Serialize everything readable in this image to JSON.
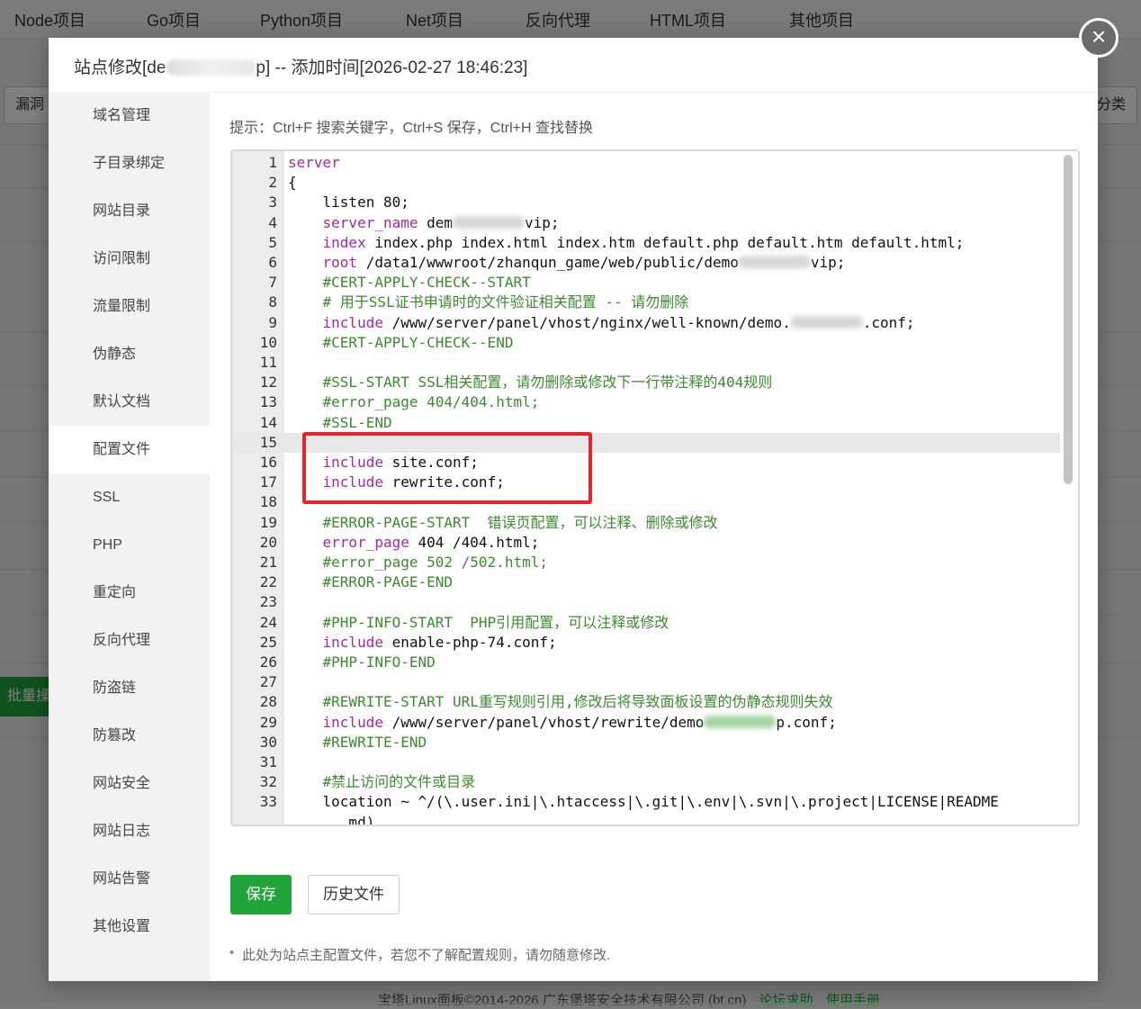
{
  "background": {
    "nav": [
      "Node项目",
      "Go项目",
      "Python项目",
      "Net项目",
      "反向代理",
      "HTML项目",
      "其他项目"
    ],
    "chip_left": "漏洞",
    "chip_right": "分类",
    "batch_button": "批量操",
    "footer": "宝塔Linux面板©2014-2026 广东堡塔安全技术有限公司 (bt.cn)",
    "footer_links": [
      "论坛求助",
      "使用手册"
    ]
  },
  "modal": {
    "title_prefix": "站点修改[de",
    "title_suffix": "p] -- 添加时间[2026-02-27 18:46:23]",
    "close_icon": "×"
  },
  "sidebar": {
    "items": [
      "域名管理",
      "子目录绑定",
      "网站目录",
      "访问限制",
      "流量限制",
      "伪静态",
      "默认文档",
      "配置文件",
      "SSL",
      "PHP",
      "重定向",
      "反向代理",
      "防盗链",
      "防篡改",
      "网站安全",
      "网站日志",
      "网站告警",
      "其他设置"
    ],
    "active_index": 7
  },
  "content": {
    "tip": "提示：Ctrl+F 搜索关键字，Ctrl+S 保存，Ctrl+H 查找替换",
    "save_button": "保存",
    "history_button": "历史文件",
    "note": "此处为站点主配置文件，若您不了解配置规则，请勿随意修改."
  },
  "editor": {
    "highlighted_line": 15,
    "lines": [
      {
        "n": "1",
        "parts": [
          [
            "kw",
            "server"
          ]
        ]
      },
      {
        "n": "2",
        "parts": [
          [
            "",
            "{"
          ]
        ]
      },
      {
        "n": "3",
        "parts": [
          [
            "",
            "    listen 80;"
          ]
        ]
      },
      {
        "n": "4",
        "parts": [
          [
            "",
            "    "
          ],
          [
            "kw",
            "server_name"
          ],
          [
            "",
            " dem"
          ],
          [
            "blur",
            ""
          ],
          [
            "",
            "vip;"
          ]
        ]
      },
      {
        "n": "5",
        "parts": [
          [
            "",
            "    "
          ],
          [
            "kw",
            "index"
          ],
          [
            "",
            " index.php index.html index.htm default.php default.htm default.html;"
          ]
        ]
      },
      {
        "n": "6",
        "parts": [
          [
            "",
            "    "
          ],
          [
            "kw",
            "root"
          ],
          [
            "",
            " /data1/wwwroot/zhanqun_game/web/public/demo"
          ],
          [
            "blur",
            ""
          ],
          [
            "",
            "vip;"
          ]
        ]
      },
      {
        "n": "7",
        "parts": [
          [
            "",
            "    "
          ],
          [
            "cmt",
            "#CERT-APPLY-CHECK--START"
          ]
        ]
      },
      {
        "n": "8",
        "parts": [
          [
            "",
            "    "
          ],
          [
            "cmt",
            "# 用于SSL证书申请时的文件验证相关配置 -- 请勿删除"
          ]
        ]
      },
      {
        "n": "9",
        "parts": [
          [
            "",
            "    "
          ],
          [
            "kw",
            "include"
          ],
          [
            "",
            " /www/server/panel/vhost/nginx/well-known/demo."
          ],
          [
            "blur",
            ""
          ],
          [
            "",
            ".conf;"
          ]
        ]
      },
      {
        "n": "10",
        "parts": [
          [
            "",
            "    "
          ],
          [
            "cmt",
            "#CERT-APPLY-CHECK--END"
          ]
        ]
      },
      {
        "n": "11",
        "parts": [
          [
            "",
            ""
          ]
        ]
      },
      {
        "n": "12",
        "parts": [
          [
            "",
            "    "
          ],
          [
            "cmt",
            "#SSL-START SSL相关配置，请勿删除或修改下一行带注释的404规则"
          ]
        ]
      },
      {
        "n": "13",
        "parts": [
          [
            "",
            "    "
          ],
          [
            "cmt",
            "#error_page 404/404.html;"
          ]
        ]
      },
      {
        "n": "14",
        "parts": [
          [
            "",
            "    "
          ],
          [
            "cmt",
            "#SSL-END"
          ]
        ]
      },
      {
        "n": "15",
        "parts": [
          [
            "",
            ""
          ]
        ]
      },
      {
        "n": "16",
        "parts": [
          [
            "",
            "    "
          ],
          [
            "kw",
            "include"
          ],
          [
            "",
            " site.conf;"
          ]
        ]
      },
      {
        "n": "17",
        "parts": [
          [
            "",
            "    "
          ],
          [
            "kw",
            "include"
          ],
          [
            "",
            " rewrite.conf;"
          ]
        ]
      },
      {
        "n": "18",
        "parts": [
          [
            "",
            ""
          ]
        ]
      },
      {
        "n": "19",
        "parts": [
          [
            "",
            "    "
          ],
          [
            "cmt",
            "#ERROR-PAGE-START  错误页配置，可以注释、删除或修改"
          ]
        ]
      },
      {
        "n": "20",
        "parts": [
          [
            "",
            "    "
          ],
          [
            "kw",
            "error_page"
          ],
          [
            "",
            " 404 /404.html;"
          ]
        ]
      },
      {
        "n": "21",
        "parts": [
          [
            "",
            "    "
          ],
          [
            "cmt",
            "#error_page 502 /502.html;"
          ]
        ]
      },
      {
        "n": "22",
        "parts": [
          [
            "",
            "    "
          ],
          [
            "cmt",
            "#ERROR-PAGE-END"
          ]
        ]
      },
      {
        "n": "23",
        "parts": [
          [
            "",
            ""
          ]
        ]
      },
      {
        "n": "24",
        "parts": [
          [
            "",
            "    "
          ],
          [
            "cmt",
            "#PHP-INFO-START  PHP引用配置，可以注释或修改"
          ]
        ]
      },
      {
        "n": "25",
        "parts": [
          [
            "",
            "    "
          ],
          [
            "kw",
            "include"
          ],
          [
            "",
            " enable-php-74.conf;"
          ]
        ]
      },
      {
        "n": "26",
        "parts": [
          [
            "",
            "    "
          ],
          [
            "cmt",
            "#PHP-INFO-END"
          ]
        ]
      },
      {
        "n": "27",
        "parts": [
          [
            "",
            ""
          ]
        ]
      },
      {
        "n": "28",
        "parts": [
          [
            "",
            "    "
          ],
          [
            "cmt",
            "#REWRITE-START URL重写规则引用,修改后将导致面板设置的伪静态规则失效"
          ]
        ]
      },
      {
        "n": "29",
        "parts": [
          [
            "",
            "    "
          ],
          [
            "kw",
            "include"
          ],
          [
            "",
            " /www/server/panel/vhost/rewrite/demo"
          ],
          [
            "blurg",
            ""
          ],
          [
            "",
            "p.conf;"
          ]
        ]
      },
      {
        "n": "30",
        "parts": [
          [
            "",
            "    "
          ],
          [
            "cmt",
            "#REWRITE-END"
          ]
        ]
      },
      {
        "n": "31",
        "parts": [
          [
            "",
            ""
          ]
        ]
      },
      {
        "n": "32",
        "parts": [
          [
            "",
            "    "
          ],
          [
            "cmt",
            "#禁止访问的文件或目录"
          ]
        ]
      },
      {
        "n": "33",
        "parts": [
          [
            "",
            "    location ~ ^/(\\.user.ini|\\.htaccess|\\.git|\\.env|\\.svn|\\.project|LICENSE|README"
          ]
        ]
      },
      {
        "n": "",
        "parts": [
          [
            "",
            "       md)"
          ]
        ]
      }
    ]
  }
}
